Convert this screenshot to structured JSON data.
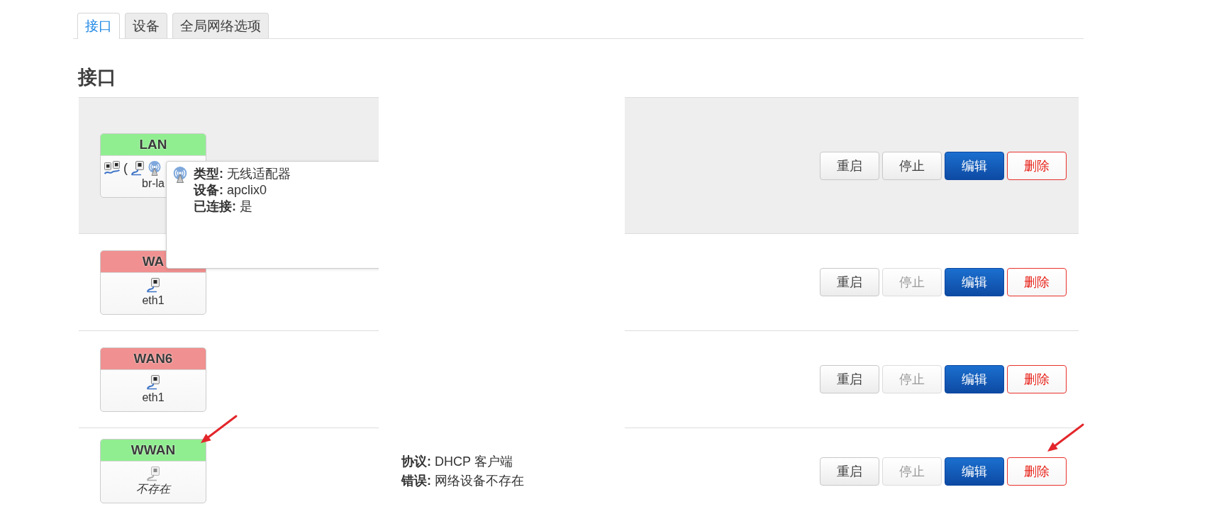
{
  "tabs": [
    {
      "label": "接口",
      "selected": true
    },
    {
      "label": "设备",
      "selected": false
    },
    {
      "label": "全局网络选项",
      "selected": false
    }
  ],
  "heading": "接口",
  "redaction_overlay": true,
  "interfaces": [
    {
      "name": "LAN",
      "color": "#90ee90",
      "highlighted": true,
      "marked": false,
      "icons": [
        {
          "kind": "bridge",
          "disabled": false
        },
        {
          "kind": "text",
          "text": "(",
          "disabled": false
        },
        {
          "kind": "ethernet",
          "disabled": false
        },
        {
          "kind": "wireless",
          "disabled": false
        }
      ],
      "device": {
        "label": "br-la",
        "missing": false
      },
      "tooltip": {
        "kind": "wireless",
        "lines": [
          "**类型:** 无线适配器",
          "**设备:** apclix0",
          "**已连接:** 是"
        ]
      },
      "buttons": [
        {
          "kind": "restart",
          "label": "重启",
          "disabled": false,
          "marked": false
        },
        {
          "kind": "stop",
          "label": "停止",
          "disabled": false,
          "marked": false
        },
        {
          "kind": "edit",
          "label": "编辑",
          "disabled": false,
          "marked": false
        },
        {
          "kind": "delete",
          "label": "删除",
          "disabled": false,
          "marked": false
        }
      ]
    },
    {
      "name": "WA",
      "color": "#f09090",
      "highlighted": false,
      "marked": false,
      "icons": [
        {
          "kind": "ethernet",
          "disabled": false
        }
      ],
      "device": {
        "label": "eth1",
        "missing": false
      },
      "buttons": [
        {
          "kind": "restart",
          "label": "重启",
          "disabled": false,
          "marked": false
        },
        {
          "kind": "stop",
          "label": "停止",
          "disabled": true,
          "marked": false
        },
        {
          "kind": "edit",
          "label": "编辑",
          "disabled": false,
          "marked": false
        },
        {
          "kind": "delete",
          "label": "删除",
          "disabled": false,
          "marked": false
        }
      ]
    },
    {
      "name": "WAN6",
      "color": "#f09090",
      "highlighted": false,
      "marked": false,
      "icons": [
        {
          "kind": "ethernet",
          "disabled": false
        }
      ],
      "device": {
        "label": "eth1",
        "missing": false
      },
      "buttons": [
        {
          "kind": "restart",
          "label": "重启",
          "disabled": false,
          "marked": false
        },
        {
          "kind": "stop",
          "label": "停止",
          "disabled": true,
          "marked": false
        },
        {
          "kind": "edit",
          "label": "编辑",
          "disabled": false,
          "marked": false
        },
        {
          "kind": "delete",
          "label": "删除",
          "disabled": false,
          "marked": false
        }
      ]
    },
    {
      "name": "WWAN",
      "color": "#90ee90",
      "highlighted": false,
      "marked": true,
      "icons": [
        {
          "kind": "ethernet",
          "disabled": true
        }
      ],
      "device": {
        "label": "不存在",
        "missing": true
      },
      "details": [
        "**协议:** DHCP 客户端",
        "**错误:** 网络设备不存在"
      ],
      "buttons": [
        {
          "kind": "restart",
          "label": "重启",
          "disabled": false,
          "marked": false
        },
        {
          "kind": "stop",
          "label": "停止",
          "disabled": true,
          "marked": false
        },
        {
          "kind": "edit",
          "label": "编辑",
          "disabled": false,
          "marked": false
        },
        {
          "kind": "delete",
          "label": "删除",
          "disabled": false,
          "marked": true
        }
      ]
    }
  ]
}
